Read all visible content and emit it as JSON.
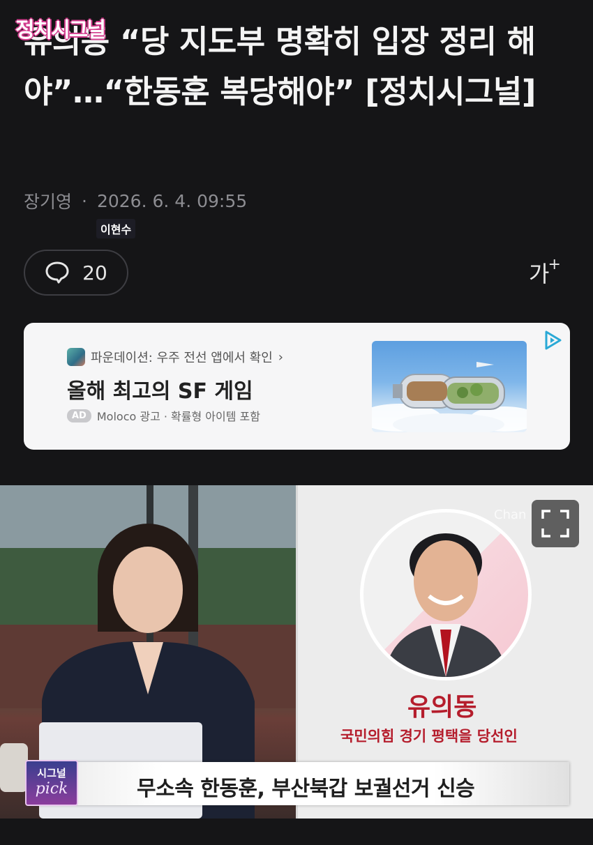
{
  "article": {
    "headline": "유의동 “당 지도부 명확히 입장 정리 해야”…“한동훈 복당해야” [정치시그널]",
    "author": "장기영",
    "separator": "·",
    "timestamp": "2026. 6. 4. 09:55"
  },
  "toolbar": {
    "comment_count": "20",
    "font_size_label": "가",
    "font_size_plus": "+"
  },
  "ad": {
    "source": "파운데이션: 우주 전선 앱에서 확인",
    "source_chevron": "›",
    "title": "올해 최고의 SF 게임",
    "badge": "AD",
    "meta": "Moloco 광고 · 확률형 아이템 포함"
  },
  "video": {
    "show_logo": "정치시그널",
    "host_name_tag": "이현수",
    "watermark": "Chan",
    "guest_name": "유의동",
    "guest_role": "국민의힘 경기 평택을 당선인",
    "pick_line1": "시그널",
    "pick_line2": "pick",
    "caption": "무소속 한동훈, 부산북갑 보궐선거 신승"
  },
  "icons": {
    "comment": "speech-bubble-icon",
    "expand": "fullscreen-icon",
    "adchoices": "adchoices-icon"
  }
}
